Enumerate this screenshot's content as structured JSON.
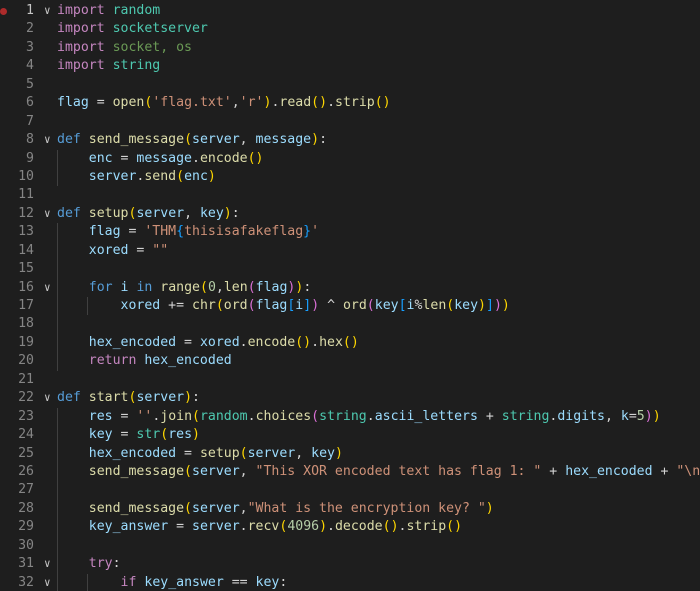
{
  "editor": {
    "language": "python",
    "active_line": 1,
    "lines": [
      {
        "n": "1",
        "indent": 0,
        "fold": true,
        "t": [
          [
            "import",
            "imp"
          ],
          [
            " random",
            "mod"
          ]
        ]
      },
      {
        "n": "2",
        "indent": 0,
        "fold": false,
        "t": [
          [
            "import",
            "imp"
          ],
          [
            " socketserver",
            "mod"
          ]
        ]
      },
      {
        "n": "3",
        "indent": 0,
        "fold": false,
        "t": [
          [
            "import",
            "imp"
          ],
          [
            " socket",
            "dim"
          ],
          [
            ", os",
            "dim"
          ]
        ]
      },
      {
        "n": "4",
        "indent": 0,
        "fold": false,
        "t": [
          [
            "import",
            "imp"
          ],
          [
            " string",
            "mod"
          ]
        ]
      },
      {
        "n": "5",
        "indent": 0,
        "fold": false,
        "t": []
      },
      {
        "n": "6",
        "indent": 0,
        "fold": false,
        "t": [
          [
            "flag",
            "var"
          ],
          [
            " = ",
            ""
          ],
          [
            "open",
            "fn"
          ],
          [
            "(",
            "b1"
          ],
          [
            "'flag.txt'",
            "str"
          ],
          [
            ",",
            ""
          ],
          [
            "'r'",
            "str"
          ],
          [
            ")",
            "b1"
          ],
          [
            ".",
            ""
          ],
          [
            "read",
            "fn"
          ],
          [
            "()",
            "b1"
          ],
          [
            ".",
            ""
          ],
          [
            "strip",
            "fn"
          ],
          [
            "()",
            "b1"
          ]
        ]
      },
      {
        "n": "7",
        "indent": 0,
        "fold": false,
        "t": []
      },
      {
        "n": "8",
        "indent": 0,
        "fold": true,
        "t": [
          [
            "def",
            "kw"
          ],
          [
            " ",
            ""
          ],
          [
            "send_message",
            "fn"
          ],
          [
            "(",
            "b1"
          ],
          [
            "server",
            "var"
          ],
          [
            ", ",
            ""
          ],
          [
            "message",
            "var"
          ],
          [
            ")",
            "b1"
          ],
          [
            ":",
            ""
          ]
        ]
      },
      {
        "n": "9",
        "indent": 1,
        "fold": false,
        "t": [
          [
            "enc",
            "var"
          ],
          [
            " = ",
            ""
          ],
          [
            "message",
            "var"
          ],
          [
            ".",
            ""
          ],
          [
            "encode",
            "fn"
          ],
          [
            "()",
            "b1"
          ]
        ]
      },
      {
        "n": "10",
        "indent": 1,
        "fold": false,
        "t": [
          [
            "server",
            "var"
          ],
          [
            ".",
            ""
          ],
          [
            "send",
            "fn"
          ],
          [
            "(",
            "b1"
          ],
          [
            "enc",
            "var"
          ],
          [
            ")",
            "b1"
          ]
        ]
      },
      {
        "n": "11",
        "indent": 0,
        "fold": false,
        "t": []
      },
      {
        "n": "12",
        "indent": 0,
        "fold": true,
        "t": [
          [
            "def",
            "kw"
          ],
          [
            " ",
            ""
          ],
          [
            "setup",
            "fn"
          ],
          [
            "(",
            "b1"
          ],
          [
            "server",
            "var"
          ],
          [
            ", ",
            ""
          ],
          [
            "key",
            "var"
          ],
          [
            ")",
            "b1"
          ],
          [
            ":",
            ""
          ]
        ]
      },
      {
        "n": "13",
        "indent": 1,
        "fold": false,
        "t": [
          [
            "flag",
            "var"
          ],
          [
            " = ",
            ""
          ],
          [
            "'THM",
            "str"
          ],
          [
            "{",
            "b3"
          ],
          [
            "thisisafakeflag",
            "str"
          ],
          [
            "}",
            "b3"
          ],
          [
            "'",
            "str"
          ]
        ]
      },
      {
        "n": "14",
        "indent": 1,
        "fold": false,
        "t": [
          [
            "xored",
            "var"
          ],
          [
            " = ",
            ""
          ],
          [
            "\"\"",
            "str"
          ]
        ]
      },
      {
        "n": "15",
        "indent": 1,
        "fold": false,
        "t": []
      },
      {
        "n": "16",
        "indent": 1,
        "fold": true,
        "t": [
          [
            "for",
            "kw"
          ],
          [
            " ",
            ""
          ],
          [
            "i",
            "var"
          ],
          [
            " ",
            ""
          ],
          [
            "in",
            "kw"
          ],
          [
            " ",
            ""
          ],
          [
            "range",
            "fn"
          ],
          [
            "(",
            "b1"
          ],
          [
            "0",
            "num"
          ],
          [
            ",",
            ""
          ],
          [
            "len",
            "fn"
          ],
          [
            "(",
            "b2"
          ],
          [
            "flag",
            "var"
          ],
          [
            ")",
            "b2"
          ],
          [
            ")",
            "b1"
          ],
          [
            ":",
            ""
          ]
        ]
      },
      {
        "n": "17",
        "indent": 2,
        "fold": false,
        "t": [
          [
            "xored",
            "var"
          ],
          [
            " += ",
            ""
          ],
          [
            "chr",
            "fn"
          ],
          [
            "(",
            "b1"
          ],
          [
            "ord",
            "fn"
          ],
          [
            "(",
            "b2"
          ],
          [
            "flag",
            "var"
          ],
          [
            "[",
            "b3"
          ],
          [
            "i",
            "var"
          ],
          [
            "]",
            "b3"
          ],
          [
            ")",
            "b2"
          ],
          [
            " ^ ",
            ""
          ],
          [
            "ord",
            "fn"
          ],
          [
            "(",
            "b2"
          ],
          [
            "key",
            "var"
          ],
          [
            "[",
            "b3"
          ],
          [
            "i",
            "var"
          ],
          [
            "%",
            ""
          ],
          [
            "len",
            "fn"
          ],
          [
            "(",
            "b1"
          ],
          [
            "key",
            "var"
          ],
          [
            ")",
            "b1"
          ],
          [
            "]",
            "b3"
          ],
          [
            ")",
            "b2"
          ],
          [
            ")",
            "b1"
          ]
        ]
      },
      {
        "n": "18",
        "indent": 1,
        "fold": false,
        "t": []
      },
      {
        "n": "19",
        "indent": 1,
        "fold": false,
        "t": [
          [
            "hex_encoded",
            "var"
          ],
          [
            " = ",
            ""
          ],
          [
            "xored",
            "var"
          ],
          [
            ".",
            ""
          ],
          [
            "encode",
            "fn"
          ],
          [
            "()",
            "b1"
          ],
          [
            ".",
            ""
          ],
          [
            "hex",
            "fn"
          ],
          [
            "()",
            "b1"
          ]
        ]
      },
      {
        "n": "20",
        "indent": 1,
        "fold": false,
        "t": [
          [
            "return",
            "imp"
          ],
          [
            " ",
            ""
          ],
          [
            "hex_encoded",
            "var"
          ]
        ]
      },
      {
        "n": "21",
        "indent": 0,
        "fold": false,
        "t": []
      },
      {
        "n": "22",
        "indent": 0,
        "fold": true,
        "t": [
          [
            "def",
            "kw"
          ],
          [
            " ",
            ""
          ],
          [
            "start",
            "fn"
          ],
          [
            "(",
            "b1"
          ],
          [
            "server",
            "var"
          ],
          [
            ")",
            "b1"
          ],
          [
            ":",
            ""
          ]
        ]
      },
      {
        "n": "23",
        "indent": 1,
        "fold": false,
        "t": [
          [
            "res",
            "var"
          ],
          [
            " = ",
            ""
          ],
          [
            "''",
            "str"
          ],
          [
            ".",
            ""
          ],
          [
            "join",
            "fn"
          ],
          [
            "(",
            "b1"
          ],
          [
            "random",
            "mod"
          ],
          [
            ".",
            ""
          ],
          [
            "choices",
            "fn"
          ],
          [
            "(",
            "b2"
          ],
          [
            "string",
            "mod"
          ],
          [
            ".",
            ""
          ],
          [
            "ascii_letters",
            "var"
          ],
          [
            " + ",
            ""
          ],
          [
            "string",
            "mod"
          ],
          [
            ".",
            ""
          ],
          [
            "digits",
            "var"
          ],
          [
            ", ",
            ""
          ],
          [
            "k",
            "var"
          ],
          [
            "=",
            ""
          ],
          [
            "5",
            "num"
          ],
          [
            ")",
            "b2"
          ],
          [
            ")",
            "b1"
          ]
        ]
      },
      {
        "n": "24",
        "indent": 1,
        "fold": false,
        "t": [
          [
            "key",
            "var"
          ],
          [
            " = ",
            ""
          ],
          [
            "str",
            "mod"
          ],
          [
            "(",
            "b1"
          ],
          [
            "res",
            "var"
          ],
          [
            ")",
            "b1"
          ]
        ]
      },
      {
        "n": "25",
        "indent": 1,
        "fold": false,
        "t": [
          [
            "hex_encoded",
            "var"
          ],
          [
            " = ",
            ""
          ],
          [
            "setup",
            "fn"
          ],
          [
            "(",
            "b1"
          ],
          [
            "server",
            "var"
          ],
          [
            ", ",
            ""
          ],
          [
            "key",
            "var"
          ],
          [
            ")",
            "b1"
          ]
        ]
      },
      {
        "n": "26",
        "indent": 1,
        "fold": false,
        "t": [
          [
            "send_message",
            "fn"
          ],
          [
            "(",
            "b1"
          ],
          [
            "server",
            "var"
          ],
          [
            ", ",
            ""
          ],
          [
            "\"This XOR encoded text has flag 1: \"",
            "str"
          ],
          [
            " + ",
            ""
          ],
          [
            "hex_encoded",
            "var"
          ],
          [
            " + ",
            ""
          ],
          [
            "\"\\n\"",
            "str"
          ],
          [
            ")",
            "b1"
          ]
        ]
      },
      {
        "n": "27",
        "indent": 1,
        "fold": false,
        "t": []
      },
      {
        "n": "28",
        "indent": 1,
        "fold": false,
        "t": [
          [
            "send_message",
            "fn"
          ],
          [
            "(",
            "b1"
          ],
          [
            "server",
            "var"
          ],
          [
            ",",
            ""
          ],
          [
            "\"What is the encryption key? \"",
            "str"
          ],
          [
            ")",
            "b1"
          ]
        ]
      },
      {
        "n": "29",
        "indent": 1,
        "fold": false,
        "t": [
          [
            "key_answer",
            "var"
          ],
          [
            " = ",
            ""
          ],
          [
            "server",
            "var"
          ],
          [
            ".",
            ""
          ],
          [
            "recv",
            "fn"
          ],
          [
            "(",
            "b1"
          ],
          [
            "4096",
            "num"
          ],
          [
            ")",
            "b1"
          ],
          [
            ".",
            ""
          ],
          [
            "decode",
            "fn"
          ],
          [
            "()",
            "b1"
          ],
          [
            ".",
            ""
          ],
          [
            "strip",
            "fn"
          ],
          [
            "()",
            "b1"
          ]
        ]
      },
      {
        "n": "30",
        "indent": 1,
        "fold": false,
        "t": []
      },
      {
        "n": "31",
        "indent": 1,
        "fold": true,
        "t": [
          [
            "try",
            "imp"
          ],
          [
            ":",
            ""
          ]
        ]
      },
      {
        "n": "32",
        "indent": 2,
        "fold": true,
        "t": [
          [
            "if",
            "imp"
          ],
          [
            " ",
            ""
          ],
          [
            "key_answer",
            "var"
          ],
          [
            " == ",
            ""
          ],
          [
            "key",
            "var"
          ],
          [
            ":",
            ""
          ]
        ]
      }
    ]
  },
  "icons": {
    "fold_icon": "chevron-down-icon",
    "breakpoint_icon": "breakpoint-dot"
  }
}
